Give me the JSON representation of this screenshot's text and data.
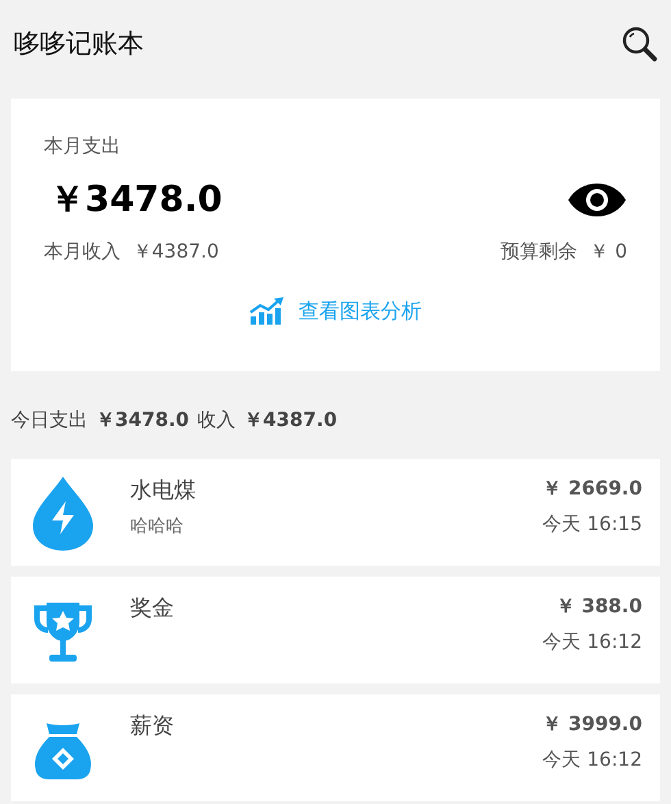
{
  "app_bar": {
    "title": "哆哆记账本"
  },
  "summary": {
    "expense_label": "本月支出",
    "expense": "￥3478.0",
    "income_label": "本月收入",
    "income": "￥4387.0",
    "budget_label": "预算剩余",
    "budget": "￥ 0",
    "chart_link": "查看图表分析"
  },
  "today": {
    "expense_label": "今日支出",
    "expense": "￥3478.0",
    "income_label": "收入",
    "income": "￥4387.0"
  },
  "records": [
    {
      "kind": "utility",
      "name": "水电煤",
      "note": "哈哈哈",
      "amount": "￥ 2669.0",
      "time": "今天 16:15"
    },
    {
      "kind": "trophy",
      "name": "奖金",
      "amount": "￥ 388.0",
      "time": "今天 16:12"
    },
    {
      "kind": "moneybag",
      "name": "薪资",
      "amount": "￥ 3999.0",
      "time": "今天 16:12"
    }
  ]
}
